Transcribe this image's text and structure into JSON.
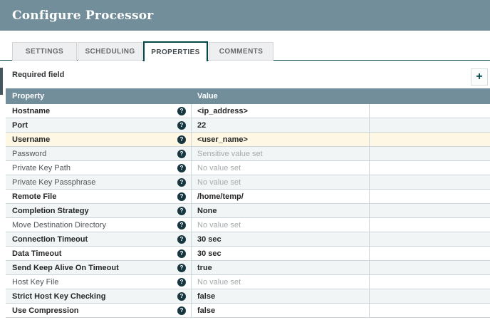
{
  "dialog": {
    "title": "Configure Processor"
  },
  "tabs": [
    {
      "label": "SETTINGS",
      "active": false
    },
    {
      "label": "SCHEDULING",
      "active": false
    },
    {
      "label": "PROPERTIES",
      "active": true
    },
    {
      "label": "COMMENTS",
      "active": false
    }
  ],
  "toolbar": {
    "required_field_label": "Required field"
  },
  "icons": {
    "help": "?",
    "add": "+"
  },
  "colors": {
    "accent": "#004849",
    "header_bar": "#728e9b",
    "row_stripe": "#f2f5f6",
    "row_highlight": "#fdf7e3"
  },
  "table": {
    "columns": [
      "Property",
      "Value"
    ],
    "rows": [
      {
        "property": "Hostname",
        "value": "<ip_address>",
        "required": true,
        "value_set": true,
        "highlight": false
      },
      {
        "property": "Port",
        "value": "22",
        "required": true,
        "value_set": true,
        "highlight": false
      },
      {
        "property": "Username",
        "value": "<user_name>",
        "required": true,
        "value_set": true,
        "highlight": true
      },
      {
        "property": "Password",
        "value": "Sensitive value set",
        "required": false,
        "value_set": false,
        "highlight": false
      },
      {
        "property": "Private Key Path",
        "value": "No value set",
        "required": false,
        "value_set": false,
        "highlight": false
      },
      {
        "property": "Private Key Passphrase",
        "value": "No value set",
        "required": false,
        "value_set": false,
        "highlight": false
      },
      {
        "property": "Remote File",
        "value": "/home/temp/",
        "required": true,
        "value_set": true,
        "highlight": false
      },
      {
        "property": "Completion Strategy",
        "value": "None",
        "required": true,
        "value_set": true,
        "highlight": false
      },
      {
        "property": "Move Destination Directory",
        "value": "No value set",
        "required": false,
        "value_set": false,
        "highlight": false
      },
      {
        "property": "Connection Timeout",
        "value": "30 sec",
        "required": true,
        "value_set": true,
        "highlight": false
      },
      {
        "property": "Data Timeout",
        "value": "30 sec",
        "required": true,
        "value_set": true,
        "highlight": false
      },
      {
        "property": "Send Keep Alive On Timeout",
        "value": "true",
        "required": true,
        "value_set": true,
        "highlight": false
      },
      {
        "property": "Host Key File",
        "value": "No value set",
        "required": false,
        "value_set": false,
        "highlight": false
      },
      {
        "property": "Strict Host Key Checking",
        "value": "false",
        "required": true,
        "value_set": true,
        "highlight": false
      },
      {
        "property": "Use Compression",
        "value": "false",
        "required": true,
        "value_set": true,
        "highlight": false
      }
    ]
  }
}
